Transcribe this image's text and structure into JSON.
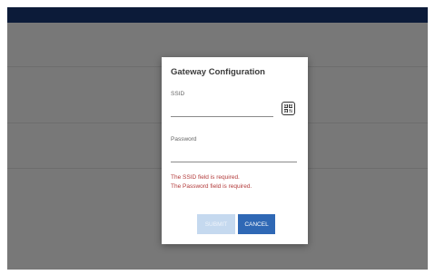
{
  "app": {
    "title": ""
  },
  "background": {
    "items": [
      "",
      "",
      "",
      ""
    ]
  },
  "dialog": {
    "title": "Gateway Configuration",
    "ssid": {
      "label": "SSID",
      "value": "",
      "placeholder": ""
    },
    "password": {
      "label": "Password",
      "value": "",
      "placeholder": ""
    },
    "errors": [
      "The SSID field is required.",
      "The Password field is required."
    ],
    "submit_label": "SUBMIT",
    "cancel_label": "CANCEL",
    "qr_icon": "qr-code-icon"
  },
  "colors": {
    "appbar": "#1a3a78",
    "error": "#b23a3a",
    "primary_button": "#2f68b5",
    "disabled_button": "#c5d9ef"
  }
}
